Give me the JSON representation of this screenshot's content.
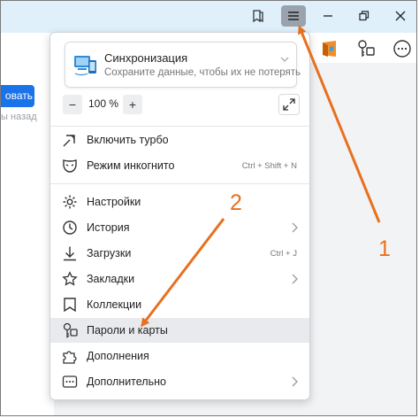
{
  "titlebar": {
    "icons": [
      "bookmark-pages-icon",
      "menu-icon",
      "minimize-icon",
      "restore-icon",
      "close-icon"
    ]
  },
  "left": {
    "button_label": "овать",
    "sub_text": "ы назад"
  },
  "toolbar": {
    "icons": [
      "extension-orange-icon",
      "passwords-cards-icon",
      "more-icon"
    ]
  },
  "menu": {
    "sync": {
      "title": "Синхронизация",
      "subtitle": "Сохраните данные, чтобы их не потерять"
    },
    "zoom": {
      "minus": "−",
      "value": "100 %",
      "plus": "+"
    },
    "items": [
      {
        "label": "Включить турбо",
        "icon": "turbo-icon"
      },
      {
        "label": "Режим инкогнито",
        "icon": "incognito-icon",
        "shortcut": "Ctrl + Shift + N"
      },
      {
        "label": "Настройки",
        "icon": "settings-icon"
      },
      {
        "label": "История",
        "icon": "history-icon",
        "submenu": true
      },
      {
        "label": "Загрузки",
        "icon": "downloads-icon",
        "shortcut": "Ctrl + J"
      },
      {
        "label": "Закладки",
        "icon": "bookmarks-icon",
        "submenu": true
      },
      {
        "label": "Коллекции",
        "icon": "collections-icon"
      },
      {
        "label": "Пароли и карты",
        "icon": "passwords-icon",
        "highlighted": true
      },
      {
        "label": "Дополнения",
        "icon": "extensions-icon"
      },
      {
        "label": "Дополнительно",
        "icon": "more-options-icon",
        "submenu": true
      }
    ]
  },
  "annotations": {
    "num1": "1",
    "num2": "2",
    "arrow_color": "#e8701e"
  }
}
